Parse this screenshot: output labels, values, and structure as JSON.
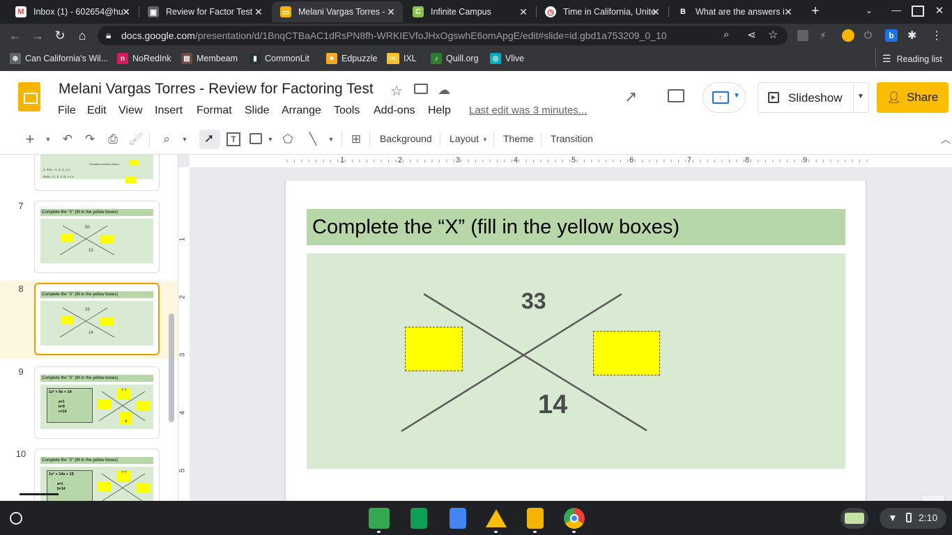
{
  "tabs": [
    {
      "label": "Inbox (1) - 602654@hu",
      "favicon": "M",
      "color": "#ffffff",
      "fg": "#ea4335"
    },
    {
      "label": "Review for Factor Test",
      "favicon": "▣",
      "color": "#5f6368",
      "fg": "#ffffff"
    },
    {
      "label": "Melani Vargas Torres - ",
      "favicon": "▭",
      "color": "#f4b400",
      "fg": "#ffffff"
    },
    {
      "label": "Infinite Campus",
      "favicon": "C",
      "color": "#8bc34a",
      "fg": "#ffffff"
    },
    {
      "label": "Time in California, Unite",
      "favicon": "◷",
      "color": "#ffffff",
      "fg": "#d93025"
    },
    {
      "label": "What are the answers i",
      "favicon": "B",
      "color": "#202124",
      "fg": "#ffffff"
    }
  ],
  "url": {
    "host": "docs.google.com",
    "path": "/presentation/d/1BnqCTBaAC1dRsPN8fh-WRKIEVfoJHxOgswhE6omApgE/edit#slide=id.gbd1a753209_0_10"
  },
  "bookmarks": [
    {
      "label": "Can California's Wil...",
      "icon": "⊕",
      "color": "#5f6368"
    },
    {
      "label": "NoRedInk",
      "icon": "n",
      "color": "#d81b60"
    },
    {
      "label": "Membeam",
      "icon": "▤",
      "color": "#6d4c41"
    },
    {
      "label": "CommonLit",
      "icon": "▮",
      "color": "#263238"
    },
    {
      "label": "Edpuzzle",
      "icon": "✶",
      "color": "#f9a825"
    },
    {
      "label": "IXL",
      "icon": "IXL",
      "color": "#fbc02d"
    },
    {
      "label": "Quill.org",
      "icon": "♪",
      "color": "#2e7d32"
    },
    {
      "label": "Vlive",
      "icon": "◎",
      "color": "#00acc1"
    }
  ],
  "reading_list": "Reading list",
  "doc": {
    "title": "Melani Vargas Torres - Review for Factoring Test",
    "menus": [
      "File",
      "Edit",
      "View",
      "Insert",
      "Format",
      "Slide",
      "Arrange",
      "Tools",
      "Add-ons",
      "Help"
    ],
    "last_edit": "Last edit was 3 minutes...",
    "slideshow": "Slideshow",
    "share": "Share"
  },
  "toolbar": {
    "background": "Background",
    "layout": "Layout",
    "theme": "Theme",
    "transition": "Transition"
  },
  "ruler": {
    "top": [
      "1",
      "2",
      "3",
      "4",
      "5",
      "6",
      "7",
      "8",
      "9"
    ],
    "left": [
      "1",
      "2",
      "3",
      "4",
      "5"
    ]
  },
  "thumbs": [
    {
      "num": "",
      "lines": [
        "Greatest common factor",
        "2.  4xx    =   1, 2, 4, x x",
        "     8xxx   =   1, 2, 4, 8, x x x",
        "Greatest common factor"
      ]
    },
    {
      "num": "7",
      "title": "Complete  the  \"X\"  (fill in the yellow boxes)",
      "top": "50",
      "bottom": "15"
    },
    {
      "num": "8",
      "title": "Complete  the  \"X\"  (fill in the yellow boxes)",
      "top": "33",
      "bottom": "14"
    },
    {
      "num": "9",
      "title": "Complete  the  \"X\"  (fill in the yellow boxes)",
      "expr": "1x² + 9x + 14",
      "vals": [
        "a=1",
        "b=9",
        "c=14"
      ],
      "q": "? ?",
      "b": "b"
    },
    {
      "num": "10",
      "title": "Complete  the  \"X\"  (fill in the yellow boxes)",
      "expr": "1x² + 14x + 15",
      "vals": [
        "a=1",
        "b=14"
      ],
      "q": "? ?"
    }
  ],
  "slide": {
    "title": "Complete  the  “X”  (fill in the yellow boxes)",
    "top_number": "33",
    "bottom_number": "14"
  },
  "colors": {
    "title_bar": "#b7d7a8",
    "body": "#d9ead3",
    "answer_box": "#ffff00",
    "share": "#fbbc04"
  },
  "status": {
    "time": "2:10"
  }
}
